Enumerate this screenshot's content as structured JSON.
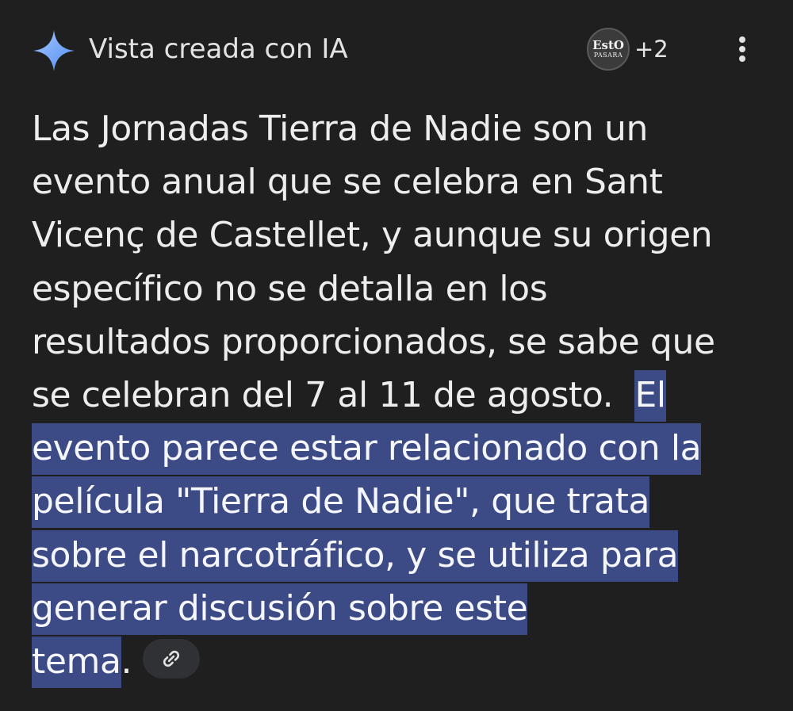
{
  "header": {
    "title": "Vista creada con IA",
    "source_avatar_line1": "EstO",
    "source_avatar_line2": "PASARA",
    "source_count": "+2",
    "sparkle_icon": "sparkle-icon",
    "more_icon": "more-vert-icon"
  },
  "answer": {
    "lines": [
      "Las Jornadas Tierra de Nadie son un",
      "evento anual que se celebra en Sant",
      "Vicenç de Castellet, y aunque su origen",
      "específico no se detalla en los",
      "resultados proporcionados, se sabe que",
      "se celebran del 7 al 11 de agosto."
    ],
    "highlight_start": "El",
    "highlighted_lines": [
      "evento parece estar relacionado con la",
      "película \"Tierra de Nadie\", que trata",
      "sobre el narcotráfico, y se utiliza para",
      "generar discusión sobre este",
      "tema"
    ],
    "end_punctuation": ".",
    "link_icon": "link-icon"
  },
  "colors": {
    "background": "#1f1f1f",
    "text": "#e3e3e3",
    "highlight": "#3c4b86",
    "chip": "#303134",
    "sparkle": "#8ab4f8"
  }
}
